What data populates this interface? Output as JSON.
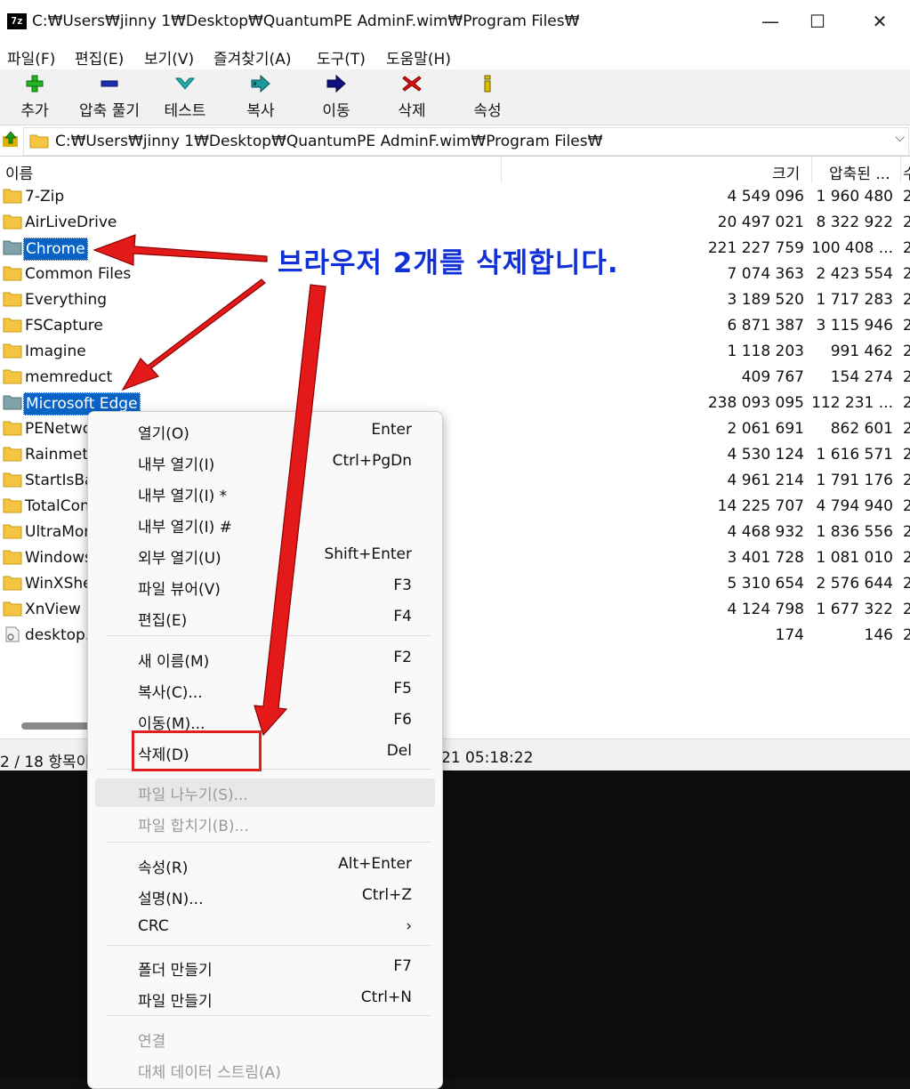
{
  "window": {
    "title": "C:₩Users₩jinny 1₩Desktop₩QuantumPE AdminF.wim₩Program Files₩",
    "app_icon_label": "7z",
    "minimize_glyph": "—",
    "maximize_glyph": "☐",
    "close_glyph": "✕"
  },
  "menubar": [
    "파일(F)",
    "편집(E)",
    "보기(V)",
    "즐겨찾기(A)",
    "도구(T)",
    "도움말(H)"
  ],
  "toolbar": [
    {
      "label": "추가",
      "icon": "add-icon",
      "color": "#22b422"
    },
    {
      "label": "압축 풀기",
      "icon": "extract-icon",
      "color": "#1a2fb5"
    },
    {
      "label": "테스트",
      "icon": "test-icon",
      "color": "#1eb4b4"
    },
    {
      "label": "복사",
      "icon": "copy-icon",
      "color": "#1a9a9a"
    },
    {
      "label": "이동",
      "icon": "move-icon",
      "color": "#101080"
    },
    {
      "label": "삭제",
      "icon": "delete-icon",
      "color": "#e01010"
    },
    {
      "label": "속성",
      "icon": "info-icon",
      "color": "#d8c000"
    }
  ],
  "address": {
    "path": "C:₩Users₩jinny 1₩Desktop₩QuantumPE AdminF.wim₩Program Files₩",
    "dropdown_glyph": "⌵"
  },
  "columns": {
    "name": "이름",
    "size": "크기",
    "packed": "압축된 ...",
    "extra": "수"
  },
  "rows": [
    {
      "name": "7-Zip",
      "size": "4 549 096",
      "packed": "1 960 480",
      "extra": "2",
      "type": "folder",
      "selected": false
    },
    {
      "name": "AirLiveDrive",
      "size": "20 497 021",
      "packed": "8 322 922",
      "extra": "2",
      "type": "folder",
      "selected": false
    },
    {
      "name": "Chrome",
      "size": "221 227 759",
      "packed": "100 408 ...",
      "extra": "2",
      "type": "folder",
      "selected": true
    },
    {
      "name": "Common Files",
      "size": "7 074 363",
      "packed": "2 423 554",
      "extra": "2",
      "type": "folder",
      "selected": false
    },
    {
      "name": "Everything",
      "size": "3 189 520",
      "packed": "1 717 283",
      "extra": "2",
      "type": "folder",
      "selected": false
    },
    {
      "name": "FSCapture",
      "size": "6 871 387",
      "packed": "3 115 946",
      "extra": "2",
      "type": "folder",
      "selected": false
    },
    {
      "name": "Imagine",
      "size": "1 118 203",
      "packed": "991 462",
      "extra": "2",
      "type": "folder",
      "selected": false
    },
    {
      "name": "memreduct",
      "size": "409 767",
      "packed": "154 274",
      "extra": "2",
      "type": "folder",
      "selected": false
    },
    {
      "name": "Microsoft Edge",
      "size": "238 093 095",
      "packed": "112 231 ...",
      "extra": "2",
      "type": "folder",
      "selected": true
    },
    {
      "name": "PENetwo",
      "size": "2 061 691",
      "packed": "862 601",
      "extra": "2",
      "type": "folder",
      "selected": false
    },
    {
      "name": "Rainmete",
      "size": "4 530 124",
      "packed": "1 616 571",
      "extra": "2",
      "type": "folder",
      "selected": false
    },
    {
      "name": "StartIsBa",
      "size": "4 961 214",
      "packed": "1 791 176",
      "extra": "2",
      "type": "folder",
      "selected": false
    },
    {
      "name": "TotalCon",
      "size": "14 225 707",
      "packed": "4 794 940",
      "extra": "2",
      "type": "folder",
      "selected": false
    },
    {
      "name": "UltraMon",
      "size": "4 468 932",
      "packed": "1 836 556",
      "extra": "2",
      "type": "folder",
      "selected": false
    },
    {
      "name": "Windows",
      "size": "3 401 728",
      "packed": "1 081 010",
      "extra": "2",
      "type": "folder",
      "selected": false
    },
    {
      "name": "WinXShe",
      "size": "5 310 654",
      "packed": "2 576 644",
      "extra": "2",
      "type": "folder",
      "selected": false
    },
    {
      "name": "XnView",
      "size": "4 124 798",
      "packed": "1 677 322",
      "extra": "2",
      "type": "folder",
      "selected": false
    },
    {
      "name": "desktop.",
      "size": "174",
      "packed": "146",
      "extra": "2",
      "type": "file",
      "selected": false
    }
  ],
  "status": {
    "left": "2 / 18 항목이",
    "right": "21 05:18:22"
  },
  "annotation": "브라우저 2개를 삭제합니다.",
  "context_menu": [
    {
      "label": "열기(O)",
      "shortcut": "Enter",
      "disabled": false
    },
    {
      "label": "내부 열기(I)",
      "shortcut": "Ctrl+PgDn",
      "disabled": false
    },
    {
      "label": "내부 열기(I) *",
      "shortcut": "",
      "disabled": false
    },
    {
      "label": "내부 열기(I) #",
      "shortcut": "",
      "disabled": false
    },
    {
      "label": "외부 열기(U)",
      "shortcut": "Shift+Enter",
      "disabled": false
    },
    {
      "label": "파일 뷰어(V)",
      "shortcut": "F3",
      "disabled": false
    },
    {
      "label": "편집(E)",
      "shortcut": "F4",
      "disabled": false
    },
    {
      "label": "새 이름(M)",
      "shortcut": "F2",
      "disabled": false
    },
    {
      "label": "복사(C)...",
      "shortcut": "F5",
      "disabled": false
    },
    {
      "label": "이동(M)...",
      "shortcut": "F6",
      "disabled": false
    },
    {
      "label": "삭제(D)",
      "shortcut": "Del",
      "disabled": false
    },
    {
      "label": "파일 나누기(S)...",
      "shortcut": "",
      "disabled": true
    },
    {
      "label": "파일 합치기(B)...",
      "shortcut": "",
      "disabled": true
    },
    {
      "label": "속성(R)",
      "shortcut": "Alt+Enter",
      "disabled": false
    },
    {
      "label": "설명(N)...",
      "shortcut": "Ctrl+Z",
      "disabled": false
    },
    {
      "label": "CRC",
      "shortcut": "›",
      "disabled": false
    },
    {
      "label": "폴더 만들기",
      "shortcut": "F7",
      "disabled": false
    },
    {
      "label": "파일 만들기",
      "shortcut": "Ctrl+N",
      "disabled": false
    },
    {
      "label": "연결",
      "shortcut": "",
      "disabled": true
    },
    {
      "label": "대체 데이터 스트림(A)",
      "shortcut": "",
      "disabled": true
    }
  ]
}
